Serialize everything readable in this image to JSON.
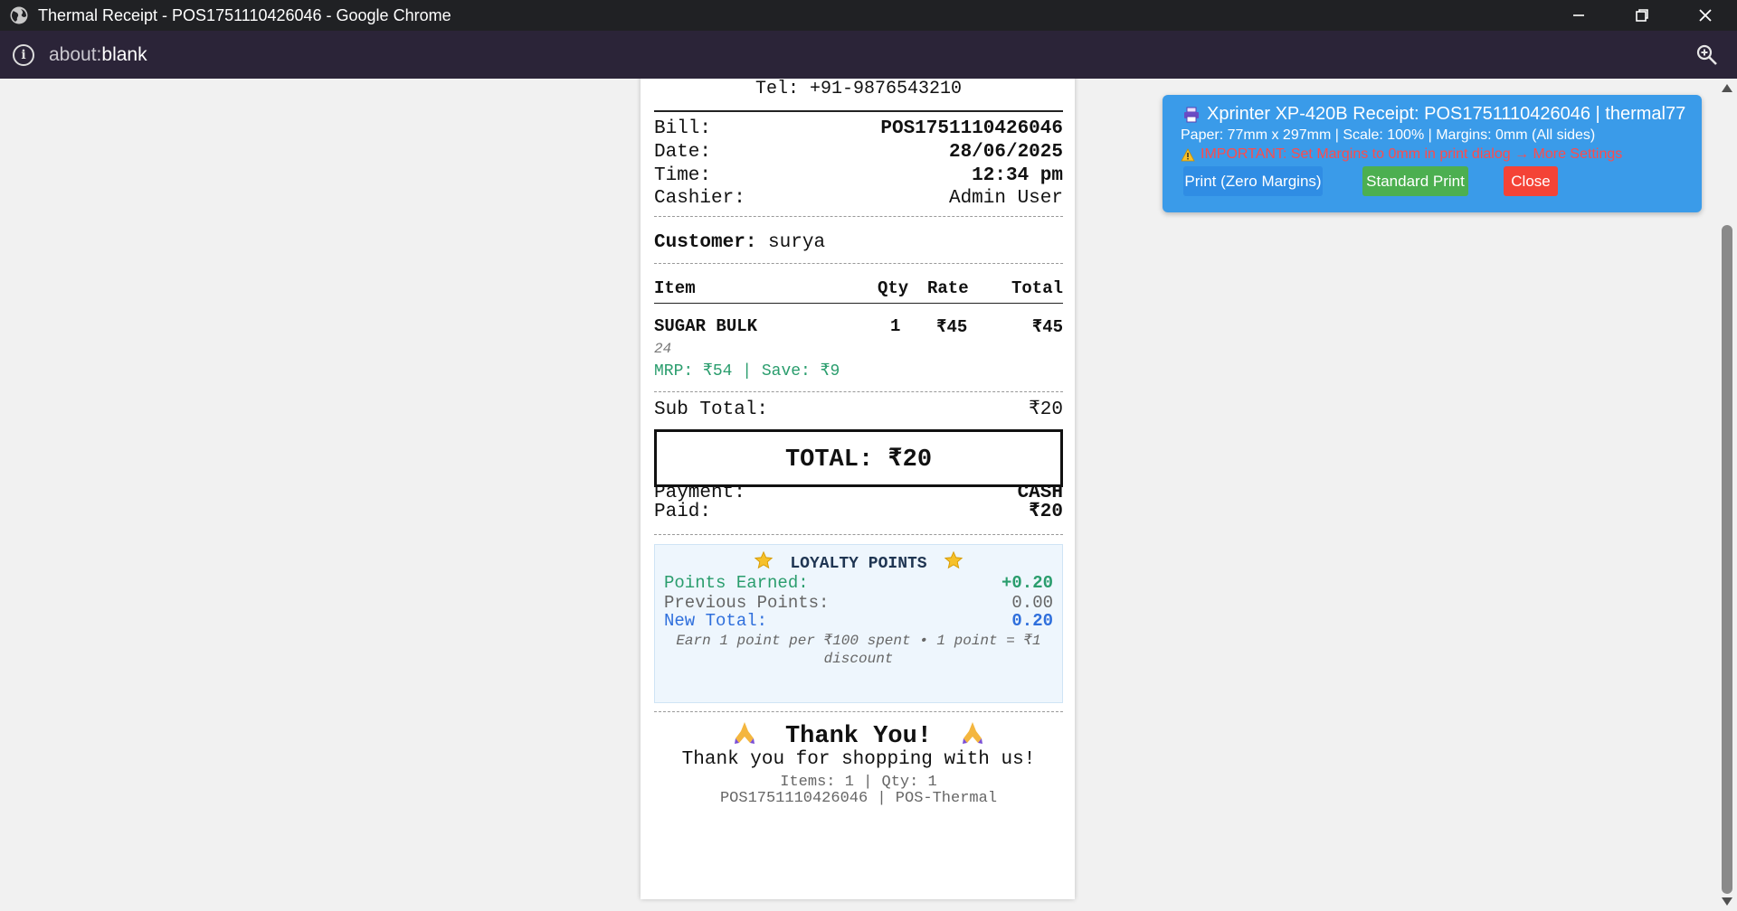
{
  "window": {
    "title": "Thermal Receipt - POS1751110426046 - Google Chrome"
  },
  "address_bar": {
    "url_dim": "about:",
    "url_main": "blank"
  },
  "receipt": {
    "tel": "Tel: +91-9876543210",
    "bill_label": "Bill:",
    "bill_value": "POS1751110426046",
    "date_label": "Date:",
    "date_value": "28/06/2025",
    "time_label": "Time:",
    "time_value": "12:34 pm",
    "cashier_label": "Cashier:",
    "cashier_value": "Admin User",
    "customer_label": "Customer:",
    "customer_value": "surya",
    "headers": {
      "item": "Item",
      "qty": "Qty",
      "rate": "Rate",
      "total": "Total"
    },
    "items": [
      {
        "name": "SUGAR BULK",
        "qty": "1",
        "rate": "₹45",
        "total": "₹45",
        "code": "24",
        "mrp_line": "MRP: ₹54 | Save: ₹9"
      }
    ],
    "subtotal_label": "Sub Total:",
    "subtotal_value": "₹20",
    "grand_total": "TOTAL: ₹20",
    "payment_label": "Payment:",
    "payment_value": "CASH",
    "paid_label": "Paid:",
    "paid_value": "₹20",
    "loyalty": {
      "title": "LOYALTY POINTS",
      "earned_label": "Points Earned:",
      "earned_value": "+0.20",
      "previous_label": "Previous Points:",
      "previous_value": "0.00",
      "new_label": "New Total:",
      "new_value": "0.20",
      "note": "Earn 1 point per ₹100 spent • 1 point = ₹1 discount"
    },
    "thank_you": "Thank You!",
    "thank_msg": "Thank you for shopping with us!",
    "footer_counts": "Items: 1 | Qty: 1",
    "footer_id": "POS1751110426046 | POS-Thermal"
  },
  "print_panel": {
    "title": "Xprinter XP-420B Receipt: POS1751110426046 | thermal77",
    "subtitle": "Paper: 77mm x 297mm | Scale: 100% | Margins: 0mm (All sides)",
    "warning": "IMPORTANT: Set Margins to 0mm in print dialog → More Settings",
    "btn_zero": "Print (Zero Margins)",
    "btn_standard": "Standard Print",
    "btn_close": "Close"
  },
  "colors": {
    "panel_bg": "#3a9be9",
    "btn_zero": "#2f8de4",
    "btn_standard": "#4caf50",
    "btn_close": "#f44336",
    "warning": "#ff4b4b",
    "points_earned": "#2a9d6d",
    "new_total": "#2f6fdc"
  },
  "icons": [
    "globe-icon",
    "minimize-icon",
    "restore-icon",
    "close-icon",
    "info-icon",
    "zoom-icon",
    "printer-icon",
    "warning-icon",
    "star-icon",
    "pray-icon"
  ]
}
